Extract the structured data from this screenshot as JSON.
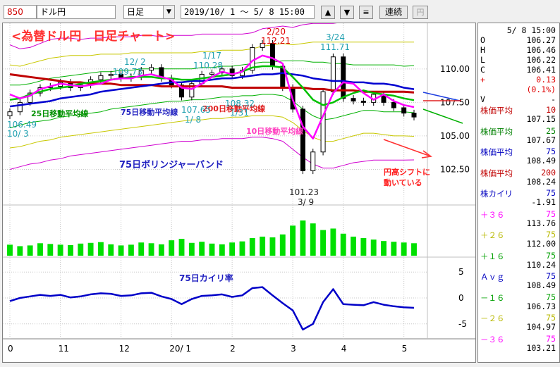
{
  "toolbar": {
    "code": "850",
    "name": "ドル円",
    "period": "日足",
    "period_arrow": "▼",
    "range": "2019/10/ 1 ～  5/ 8 15:00",
    "up": "▲",
    "down": "▼",
    "menu": "≡",
    "continuous": "連続",
    "yen": "円"
  },
  "colors": {
    "candle": "#000000",
    "ma10": "#ff00ff",
    "ma25": "#00c000",
    "ma75": "#0000d0",
    "ma200": "#c00000",
    "band3": "#d000d0",
    "band2": "#c8c800",
    "band1": "#00b000",
    "volume": "#00e000",
    "deviation": "#0000c8",
    "annot_red": "#ff0000",
    "annot_blue": "#2020c0",
    "annot_cyan": "#20b0c0",
    "annot_pink": "#ff40c0"
  },
  "chart_data": {
    "type": "line",
    "title": "<為替ドル円　日足チャート>",
    "x_tick_labels": [
      "0",
      "11",
      "12",
      "20/ 1",
      "2",
      "3",
      "4",
      "5"
    ],
    "price_axis": {
      "ticks": [
        110.0,
        107.5,
        105.0,
        102.5
      ],
      "tick_labels": [
        "110.00",
        "107.50",
        "105.00",
        "102.50"
      ],
      "ylim": [
        100.0,
        113.2
      ]
    },
    "deviation_axis": {
      "ticks": [
        5,
        0,
        -5
      ],
      "tick_labels": [
        "5",
        "0",
        "-5"
      ],
      "ylim": [
        -6.8,
        6.8
      ]
    },
    "series": [
      {
        "name": "10日移動平均線",
        "values": [
          108.1,
          107.8,
          108.0,
          108.5,
          108.7,
          108.9,
          108.8,
          108.7,
          108.8,
          108.9,
          109.2,
          109.3,
          109.3,
          109.5,
          109.6,
          109.4,
          109.2,
          108.6,
          108.5,
          108.9,
          109.4,
          109.8,
          109.6,
          109.8,
          110.6,
          111.0,
          110.8,
          110.4,
          107.7,
          105.7,
          104.8,
          106.5,
          108.2,
          109.0,
          108.9,
          108.2,
          107.7,
          108.1,
          107.6,
          107.3,
          107.15
        ]
      },
      {
        "name": "25日移動平均線",
        "values": [
          107.7,
          107.8,
          108.1,
          108.3,
          108.5,
          108.6,
          108.7,
          108.9,
          109.0,
          109.1,
          109.2,
          109.3,
          109.4,
          109.4,
          109.4,
          109.3,
          109.3,
          109.2,
          109.2,
          109.3,
          109.4,
          109.5,
          109.6,
          109.8,
          110.1,
          110.2,
          110.2,
          110.1,
          109.4,
          108.6,
          107.7,
          107.3,
          107.5,
          107.9,
          108.2,
          108.4,
          108.2,
          108.1,
          108.0,
          107.8,
          107.67
        ]
      },
      {
        "name": "75日移動平均線",
        "values": [
          107.2,
          107.3,
          107.4,
          107.5,
          107.6,
          107.8,
          107.9,
          108.0,
          108.1,
          108.3,
          108.4,
          108.5,
          108.6,
          108.7,
          108.8,
          108.9,
          109.0,
          109.0,
          109.1,
          109.1,
          109.2,
          109.3,
          109.3,
          109.4,
          109.5,
          109.6,
          109.6,
          109.7,
          109.6,
          109.5,
          109.3,
          109.2,
          109.1,
          109.1,
          109.0,
          109.0,
          108.9,
          108.9,
          108.8,
          108.6,
          108.49
        ]
      },
      {
        "name": "200日移動平均線",
        "values": [
          109.6,
          109.5,
          109.4,
          109.3,
          109.2,
          109.1,
          109.0,
          109.0,
          108.9,
          108.9,
          108.9,
          108.8,
          108.8,
          108.8,
          108.8,
          108.7,
          108.7,
          108.7,
          108.7,
          108.7,
          108.7,
          108.7,
          108.6,
          108.6,
          108.6,
          108.6,
          108.6,
          108.6,
          108.6,
          108.6,
          108.5,
          108.5,
          108.4,
          108.4,
          108.4,
          108.3,
          108.3,
          108.3,
          108.3,
          108.3,
          108.24
        ]
      },
      {
        "name": "close",
        "values": [
          106.8,
          107.5,
          108.2,
          108.6,
          108.7,
          109.0,
          108.6,
          108.8,
          109.2,
          109.5,
          109.6,
          109.3,
          109.4,
          109.9,
          110.1,
          109.3,
          108.8,
          107.9,
          108.9,
          109.6,
          109.7,
          110.0,
          109.5,
          109.9,
          111.6,
          111.9,
          110.2,
          108.6,
          107.0,
          102.4,
          103.8,
          108.3,
          110.9,
          107.8,
          107.6,
          107.5,
          108.1,
          107.5,
          107.1,
          106.7,
          106.41
        ]
      },
      {
        "name": "+3σ",
        "values": [
          111.8,
          111.5,
          111.6,
          111.9,
          112.2,
          112.3,
          112.3,
          112.2,
          112.3,
          112.3,
          112.4,
          112.4,
          112.4,
          112.5,
          112.5,
          112.4,
          112.5,
          112.5,
          112.5,
          112.6,
          112.6,
          112.6,
          112.6,
          112.6,
          112.7,
          113.0,
          113.1,
          113.2,
          113.1,
          113.3,
          113.4,
          113.4,
          113.4,
          113.5,
          113.5,
          113.6,
          113.6,
          113.6,
          113.7,
          113.7,
          113.76
        ]
      },
      {
        "name": "+2σ",
        "values": [
          110.3,
          110.2,
          110.4,
          110.6,
          110.8,
          110.9,
          111.0,
          111.0,
          111.0,
          111.1,
          111.1,
          111.1,
          111.2,
          111.2,
          111.2,
          111.2,
          111.2,
          111.2,
          111.2,
          111.3,
          111.3,
          111.4,
          111.4,
          111.4,
          111.5,
          111.7,
          111.8,
          111.9,
          111.8,
          111.9,
          112.0,
          112.0,
          112.0,
          112.0,
          112.0,
          112.0,
          112.0,
          112.0,
          112.0,
          112.0,
          112.0
        ]
      },
      {
        "name": "+1σ",
        "values": [
          108.8,
          108.8,
          108.9,
          109.1,
          109.3,
          109.4,
          109.5,
          109.6,
          109.7,
          109.8,
          109.8,
          109.9,
          109.9,
          110.0,
          110.0,
          110.0,
          110.0,
          110.0,
          110.0,
          110.1,
          110.1,
          110.2,
          110.2,
          110.3,
          110.4,
          110.5,
          110.5,
          110.6,
          110.6,
          110.6,
          110.5,
          110.5,
          110.4,
          110.4,
          110.3,
          110.3,
          110.3,
          110.3,
          110.3,
          110.2,
          110.24
        ]
      },
      {
        "name": "-1σ",
        "values": [
          105.6,
          105.8,
          106.0,
          106.1,
          106.2,
          106.4,
          106.5,
          106.6,
          106.7,
          106.8,
          107.0,
          107.1,
          107.2,
          107.3,
          107.4,
          107.5,
          107.6,
          107.6,
          107.7,
          107.7,
          107.8,
          107.9,
          107.9,
          108.0,
          108.0,
          108.1,
          108.1,
          108.0,
          107.6,
          107.0,
          106.5,
          106.2,
          106.3,
          106.5,
          106.7,
          106.9,
          106.9,
          106.8,
          106.8,
          106.8,
          106.73
        ]
      },
      {
        "name": "-2σ",
        "values": [
          104.1,
          104.2,
          104.4,
          104.6,
          104.7,
          104.9,
          105.0,
          105.1,
          105.2,
          105.3,
          105.4,
          105.5,
          105.6,
          105.7,
          105.8,
          105.9,
          106.0,
          106.1,
          106.2,
          106.2,
          106.3,
          106.3,
          106.4,
          106.4,
          106.5,
          106.5,
          106.5,
          106.4,
          106.0,
          105.4,
          104.9,
          104.6,
          104.6,
          104.8,
          105.0,
          105.2,
          105.2,
          105.1,
          105.0,
          105.0,
          104.97
        ]
      },
      {
        "name": "-3σ",
        "values": [
          102.5,
          102.7,
          102.9,
          103.0,
          103.2,
          103.3,
          103.5,
          103.6,
          103.7,
          103.8,
          103.9,
          104.0,
          104.1,
          104.2,
          104.3,
          104.4,
          104.5,
          104.6,
          104.6,
          104.7,
          104.7,
          104.8,
          104.8,
          104.8,
          104.9,
          104.9,
          104.8,
          104.6,
          104.0,
          103.4,
          102.9,
          102.6,
          102.6,
          102.8,
          103.0,
          103.1,
          103.2,
          103.2,
          103.2,
          103.2,
          103.21
        ]
      },
      {
        "name": "75日カイリ率",
        "values": [
          -0.6,
          0.0,
          0.3,
          0.6,
          0.4,
          0.6,
          0.1,
          0.3,
          0.7,
          0.9,
          0.8,
          0.4,
          0.5,
          0.9,
          1.0,
          0.3,
          -0.2,
          -1.2,
          -0.2,
          0.4,
          0.5,
          0.7,
          0.2,
          0.5,
          1.9,
          2.1,
          0.5,
          -1.0,
          -2.4,
          -6.1,
          -5.0,
          -0.8,
          1.7,
          -1.2,
          -1.3,
          -1.4,
          -0.8,
          -1.3,
          -1.6,
          -1.8,
          -1.91
        ]
      },
      {
        "name": "volume",
        "values": [
          30,
          26,
          28,
          34,
          32,
          30,
          29,
          33,
          35,
          37,
          31,
          28,
          30,
          36,
          34,
          31,
          42,
          46,
          35,
          38,
          33,
          31,
          36,
          39,
          48,
          52,
          50,
          58,
          82,
          96,
          88,
          70,
          74,
          60,
          52,
          48,
          44,
          40,
          38,
          36,
          34
        ]
      }
    ],
    "annotations": [
      {
        "text": "2/20",
        "value": "112.21",
        "color": "red"
      },
      {
        "text": "3/24",
        "value": "111.71",
        "color": "cyan"
      },
      {
        "text": "12/ 2",
        "value": "109.73",
        "color": "cyan"
      },
      {
        "text": "1/17",
        "value": "110.28",
        "color": "cyan"
      },
      {
        "text": "106.49",
        "value": "10/ 3",
        "color": "cyan"
      },
      {
        "text": "107.65",
        "value": "1/ 8",
        "color": "cyan"
      },
      {
        "text": "108.32",
        "value": "1/31",
        "color": "cyan"
      },
      {
        "text": "101.23",
        "value": "3/ 9",
        "color": "black"
      },
      {
        "text": "25日移動平均線",
        "color": "green"
      },
      {
        "text": "75日移動平均線",
        "color": "blue"
      },
      {
        "text": "200日移動平均線",
        "color": "red"
      },
      {
        "text": "10日移動平均線",
        "color": "pink"
      },
      {
        "text": "75日ボリンジャーバンド",
        "color": "blue"
      },
      {
        "text": "円高シフトに",
        "color": "red"
      },
      {
        "text": "動いている",
        "color": "red"
      },
      {
        "text": "75日カイリ率",
        "color": "blue"
      }
    ]
  },
  "sidebar": {
    "date": "5/ 8 15:00",
    "ohlc": [
      {
        "label": "O",
        "value": "106.27"
      },
      {
        "label": "H",
        "value": "106.46"
      },
      {
        "label": "L",
        "value": "106.22"
      },
      {
        "label": "C",
        "value": "106.41"
      },
      {
        "label": "+",
        "value": "0.13"
      }
    ],
    "change_pct": "(0.1%)",
    "volume_label": "V",
    "volume_value": "-",
    "indicators": [
      {
        "label": "株価平均",
        "param": "10",
        "value": "107.15",
        "color": "#c00000"
      },
      {
        "label": "株価平均",
        "param": "25",
        "value": "107.67",
        "color": "#008000"
      },
      {
        "label": "株価平均",
        "param": "75",
        "value": "108.49",
        "color": "#0000c0"
      },
      {
        "label": "株価平均",
        "param": "200",
        "value": "108.24",
        "color": "#c00000"
      },
      {
        "label": "株カイリ",
        "param": "75",
        "value": "-1.91",
        "color": "#0000c0"
      },
      {
        "label": "＋３６",
        "param": "75",
        "value": "113.76",
        "color": "#ff00ff"
      },
      {
        "label": "＋２６",
        "param": "75",
        "value": "112.00",
        "color": "#b8b800"
      },
      {
        "label": "＋１６",
        "param": "75",
        "value": "110.24",
        "color": "#00a000"
      },
      {
        "label": "Ａｖｇ",
        "param": "75",
        "value": "108.49",
        "color": "#0000c0"
      },
      {
        "label": "－１６",
        "param": "75",
        "value": "106.73",
        "color": "#00a000"
      },
      {
        "label": "－２６",
        "param": "75",
        "value": "104.97",
        "color": "#b8b800"
      },
      {
        "label": "－３６",
        "param": "75",
        "value": "103.21",
        "color": "#ff00ff"
      }
    ]
  }
}
